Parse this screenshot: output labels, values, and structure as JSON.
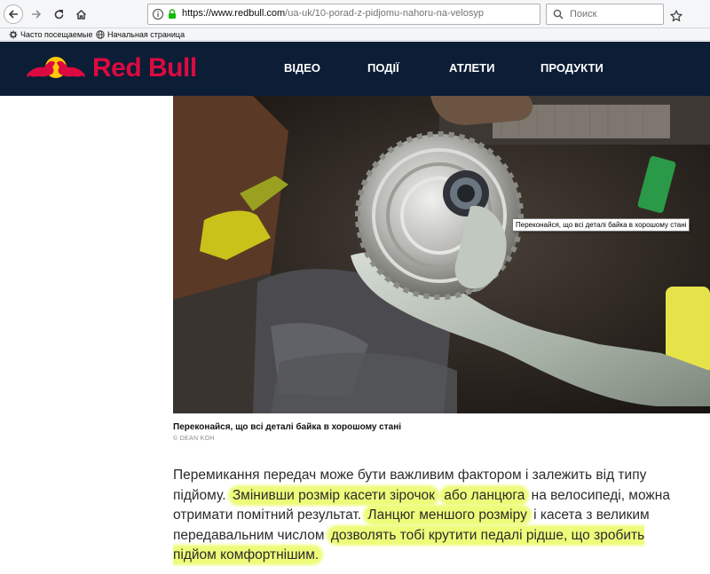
{
  "browser": {
    "url_domain": "https://www.redbull.com",
    "url_path": "/ua-uk/10-porad-z-pidjomu-nahoru-na-velosyp",
    "search_placeholder": "Поиск",
    "bookmarks": [
      {
        "label": "Часто посещаемые",
        "icon": "gear-icon"
      },
      {
        "label": "Начальная страница",
        "icon": "globe-icon"
      }
    ]
  },
  "site": {
    "logo_text": "Red Bull",
    "nav": [
      "ВІДЕО",
      "ПОДІЇ",
      "АТЛЕТИ",
      "ПРОДУКТИ"
    ],
    "brand_red": "#db0a40",
    "header_bg": "#0c1d36"
  },
  "image": {
    "tooltip": "Переконайся, що всі деталі байка в хорошому стані",
    "caption": "Переконайся, що всі деталі байка в хорошому стані",
    "credit": "© DEAN KOH"
  },
  "article": {
    "p1": "Перемикання передач може бути важливим фактором і залежить від типу підйому. ",
    "h1": "Змінивши розмір касети зірочок",
    "p2": " ",
    "h2": "або ланцюга",
    "p3": " на велосипеді, можна отримати помітний результат. ",
    "h3": "Ланцюг меншого розміру",
    "p4": " і касета з великим передавальним числом ",
    "h4": "дозволять тобі крутити педалі рідше, що зробить підйом комфортнішим.",
    "highlight_color": "#eefc7a"
  }
}
